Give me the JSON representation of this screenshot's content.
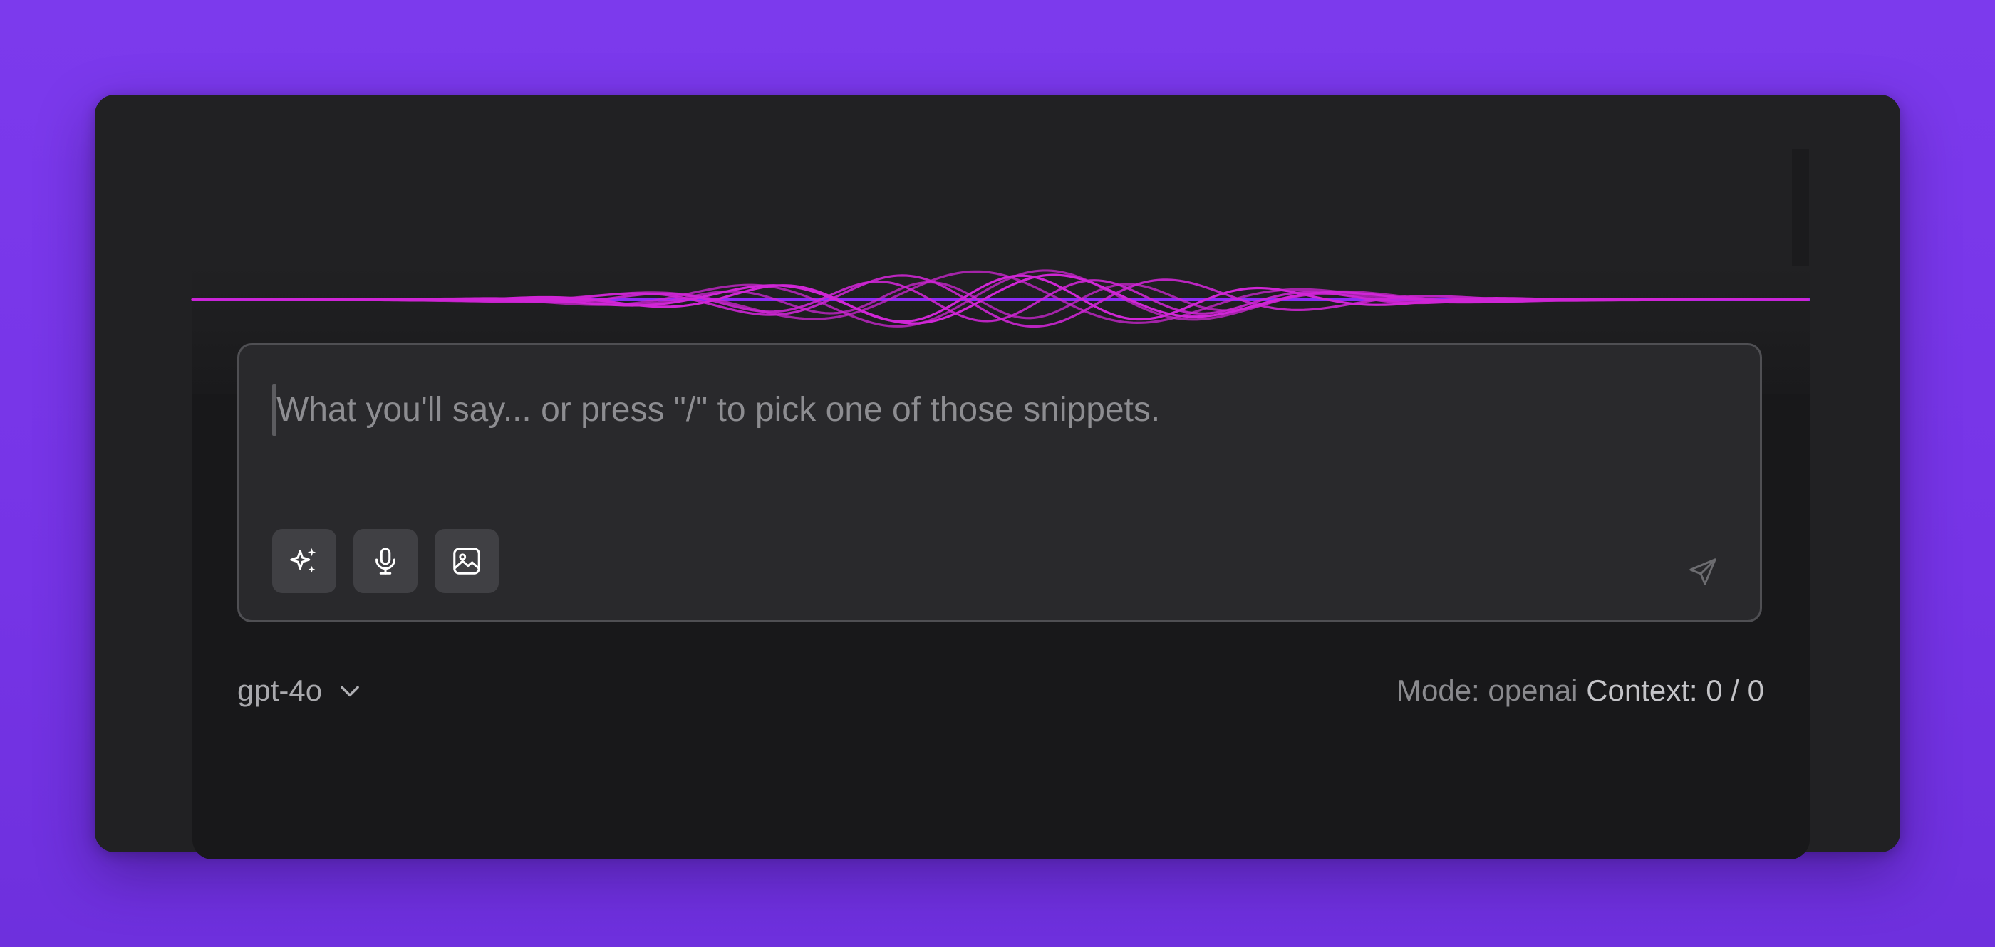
{
  "composer": {
    "placeholder": "What you'll say... or press \"/\" to pick one of those snippets.",
    "tools": [
      {
        "icon": "sparkles-icon",
        "action": "ai-assist"
      },
      {
        "icon": "microphone-icon",
        "action": "voice-input"
      },
      {
        "icon": "image-icon",
        "action": "attach-image"
      }
    ],
    "send_icon": "send-icon"
  },
  "footer": {
    "model": "gpt-4o",
    "mode_label": "Mode: openai",
    "context_label": "Context: 0 / 0"
  },
  "colors": {
    "background": "#7c3aed",
    "window": "#212123",
    "panel": "#18181a",
    "input": "#29292c",
    "wave": "#d026d6",
    "wave_line": "#8b2cf5"
  }
}
